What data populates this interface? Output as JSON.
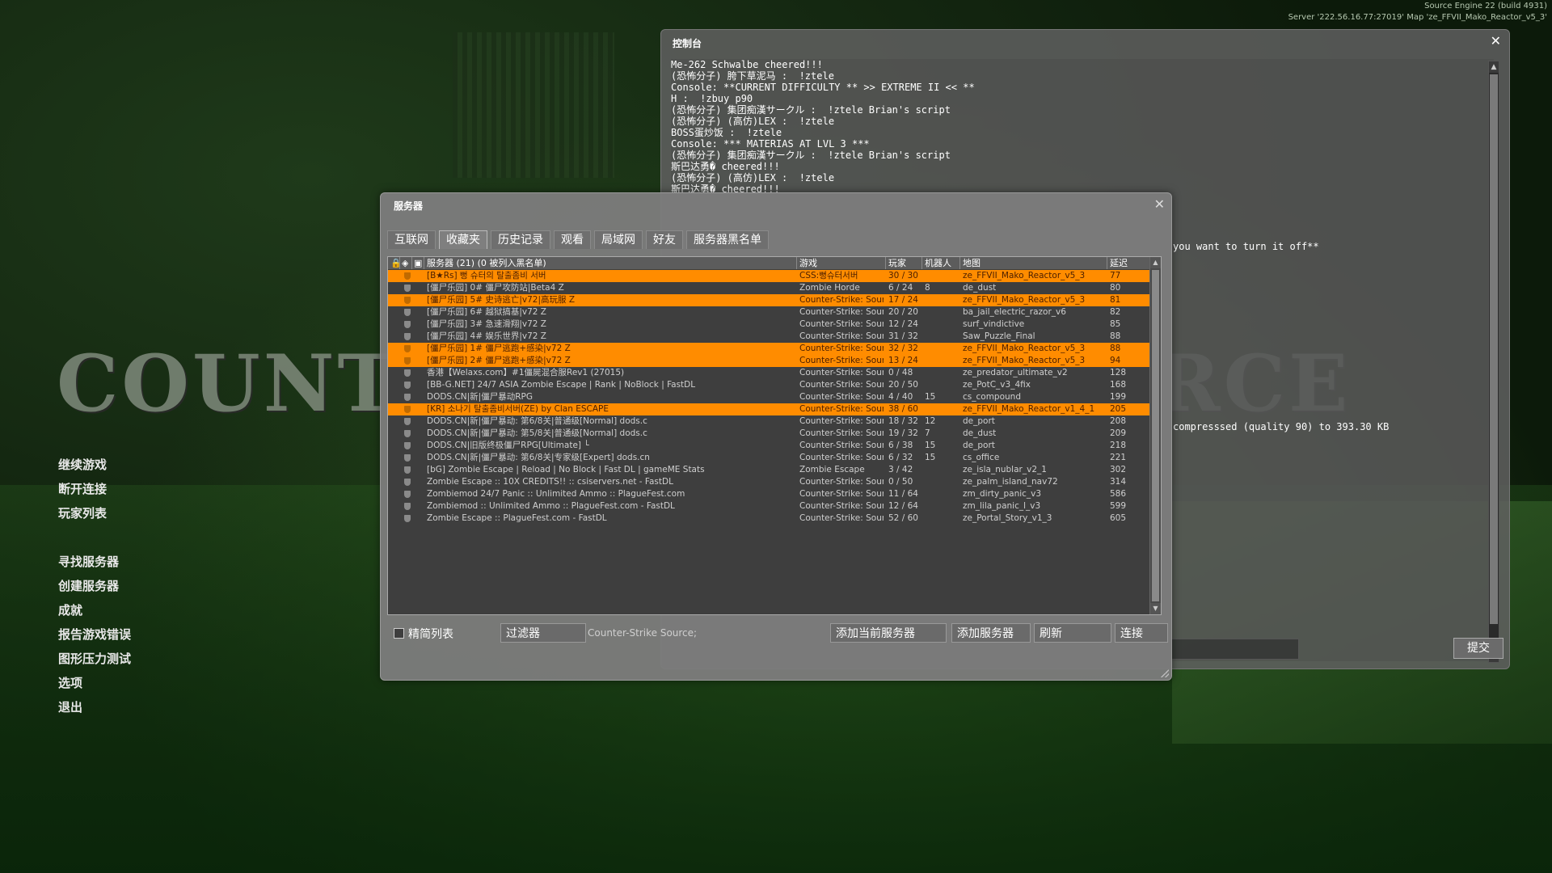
{
  "engine_info": {
    "line1": "Source Engine 22 (build 4931)",
    "line2": "Server '222.56.16.77:27019' Map 'ze_FFVII_Mako_Reactor_v5_3'"
  },
  "logo_text": "COUNTER-STRIKE SOURCE",
  "main_menu": {
    "group1": [
      "继续游戏",
      "断开连接",
      "玩家列表"
    ],
    "group2": [
      "寻找服务器",
      "创建服务器",
      "成就",
      "报告游戏错误",
      "图形压力测试",
      "选项",
      "退出"
    ]
  },
  "console": {
    "title": "控制台",
    "lines": [
      "Me-262 Schwalbe cheered!!!",
      "(恐怖分子) 胯下草泥马 :  !ztele",
      "Console: **CURRENT DIFFICULTY ** >> EXTREME II << **",
      "H :  !zbuy p90",
      "(恐怖分子) 集团痴漢サークル :  !ztele Brian's script",
      "(恐怖分子) (高仿)LEX :  !ztele",
      "BOSS蛋炒饭 :  !ztele",
      "Console: *** MATERIAS AT LVL 3 ***",
      "(恐怖分子) 集团痴漢サークル :  !ztele Brian's script",
      "斯巴达勇� cheered!!!",
      "(恐怖分子) (高仿)LEX :  !ztele",
      "斯巴达勇� cheered!!!"
    ],
    "partial_line_1": "you want to turn it off**",
    "partial_line_2": "compresssed (quality 90) to 393.30 KB",
    "submit_label": "提交",
    "command_value": ""
  },
  "servers": {
    "title": "服务器",
    "tabs": [
      "互联网",
      "收藏夹",
      "历史记录",
      "观看",
      "局域网",
      "好友",
      "服务器黑名单"
    ],
    "active_tab_index": 1,
    "columns": {
      "name": "服务器 (21) (0 被列入黑名单)",
      "game": "游戏",
      "players": "玩家",
      "bots": "机器人",
      "map": "地图",
      "latency": "延迟"
    },
    "rows": [
      {
        "name": "[B★Rs] 뻥 슈터의 탈출좀비 서버",
        "game": "CSS:뻥슈터서버",
        "players": "30 / 30",
        "bots": "",
        "map": "ze_FFVII_Mako_Reactor_v5_3",
        "latency": "77",
        "fav": true
      },
      {
        "name": "[僵尸乐园] 0# 僵尸攻防站|Beta4 Z",
        "game": "Zombie Horde",
        "players": "6 / 24",
        "bots": "8",
        "map": "de_dust",
        "latency": "80",
        "fav": false
      },
      {
        "name": "[僵尸乐园] 5# 史诗逃亡|v72|高玩服 Z",
        "game": "Counter-Strike: Source",
        "players": "17 / 24",
        "bots": "",
        "map": "ze_FFVII_Mako_Reactor_v5_3",
        "latency": "81",
        "fav": true
      },
      {
        "name": "[僵尸乐园] 6# 越狱搞基|v72 Z",
        "game": "Counter-Strike: Source",
        "players": "20 / 20",
        "bots": "",
        "map": "ba_jail_electric_razor_v6",
        "latency": "82",
        "fav": false
      },
      {
        "name": "[僵尸乐园] 3# 急速滑翔|v72 Z",
        "game": "Counter-Strike: Source",
        "players": "12 / 24",
        "bots": "",
        "map": "surf_vindictive",
        "latency": "85",
        "fav": false
      },
      {
        "name": "[僵尸乐园] 4# 娱乐世界|v72 Z",
        "game": "Counter-Strike: Source",
        "players": "31 / 32",
        "bots": "",
        "map": "Saw_Puzzle_Final",
        "latency": "88",
        "fav": false
      },
      {
        "name": "[僵尸乐园] 1# 僵尸逃跑+感染|v72 Z",
        "game": "Counter-Strike: Source",
        "players": "32 / 32",
        "bots": "",
        "map": "ze_FFVII_Mako_Reactor_v5_3",
        "latency": "88",
        "fav": true
      },
      {
        "name": "[僵尸乐园] 2# 僵尸逃跑+感染|v72 Z",
        "game": "Counter-Strike: Source",
        "players": "13 / 24",
        "bots": "",
        "map": "ze_FFVII_Mako_Reactor_v5_3",
        "latency": "94",
        "fav": true
      },
      {
        "name": "香港【Welaxs.com】#1僵屍混合服Rev1 (27015)",
        "game": "Counter-Strike: Source",
        "players": "0 / 48",
        "bots": "",
        "map": "ze_predator_ultimate_v2",
        "latency": "128",
        "fav": false
      },
      {
        "name": "[BB-G.NET] 24/7 ASIA Zombie Escape | Rank | NoBlock | FastDL",
        "game": "Counter-Strike: Source",
        "players": "20 / 50",
        "bots": "",
        "map": "ze_PotC_v3_4fix",
        "latency": "168",
        "fav": false
      },
      {
        "name": "DODS.CN|新|僵尸暴动RPG",
        "game": "Counter-Strike: Source",
        "players": "4 / 40",
        "bots": "15",
        "map": "cs_compound",
        "latency": "199",
        "fav": false
      },
      {
        "name": "[KR] 소나기 탈출좀비서버(ZE) by Clan ESCAPE",
        "game": "Counter-Strike: Source",
        "players": "38 / 60",
        "bots": "",
        "map": "ze_FFVII_Mako_Reactor_v1_4_1",
        "latency": "205",
        "fav": true
      },
      {
        "name": "DODS.CN|新|僵尸暴动: 第6/8关|普通级[Normal]  dods.c",
        "game": "Counter-Strike: Source",
        "players": "18 / 32",
        "bots": "12",
        "map": "de_port",
        "latency": "208",
        "fav": false
      },
      {
        "name": "DODS.CN|新|僵尸暴动: 第5/8关|普通级[Normal]  dods.c",
        "game": "Counter-Strike: Source",
        "players": "19 / 32",
        "bots": "7",
        "map": "de_dust",
        "latency": "209",
        "fav": false
      },
      {
        "name": "DODS.CN|旧版终极僵尸RPG[Ultimate] └",
        "game": "Counter-Strike: Source",
        "players": "6 / 38",
        "bots": "15",
        "map": "de_port",
        "latency": "218",
        "fav": false
      },
      {
        "name": "DODS.CN|新|僵尸暴动: 第6/8关|专家级[Expert]  dods.cn",
        "game": "Counter-Strike: Source",
        "players": "6 / 32",
        "bots": "15",
        "map": "cs_office",
        "latency": "221",
        "fav": false
      },
      {
        "name": "[bG] Zombie Escape | Reload | No Block | Fast DL | gameME Stats",
        "game": "Zombie Escape",
        "players": "3 / 42",
        "bots": "",
        "map": "ze_isla_nublar_v2_1",
        "latency": "302",
        "fav": false
      },
      {
        "name": "Zombie Escape :: 10X CREDITS!! :: csiservers.net - FastDL",
        "game": "Counter-Strike: Source",
        "players": "0 / 50",
        "bots": "",
        "map": "ze_palm_island_nav72",
        "latency": "314",
        "fav": false
      },
      {
        "name": "Zombiemod 24/7 Panic :: Unlimited Ammo :: PlagueFest.com",
        "game": "Counter-Strike: Source",
        "players": "11 / 64",
        "bots": "",
        "map": "zm_dirty_panic_v3",
        "latency": "586",
        "fav": false
      },
      {
        "name": "Zombiemod :: Unlimited Ammo :: PlagueFest.com - FastDL",
        "game": "Counter-Strike: Source",
        "players": "12 / 64",
        "bots": "",
        "map": "zm_lila_panic_l_v3",
        "latency": "599",
        "fav": false
      },
      {
        "name": "Zombie Escape :: PlagueFest.com - FastDL",
        "game": "Counter-Strike: Source",
        "players": "52 / 60",
        "bots": "",
        "map": "ze_Portal_Story_v1_3",
        "latency": "605",
        "fav": false
      }
    ],
    "compact_list_label": "精简列表",
    "filter_button": "过滤器",
    "filter_summary": "Counter-Strike Source;",
    "add_current_button": "添加当前服务器",
    "add_server_button": "添加服务器",
    "refresh_button": "刷新",
    "connect_button": "连接",
    "colors": {
      "favorite_row": "#ff8c00",
      "window_bg": "#7c7c7c"
    }
  }
}
